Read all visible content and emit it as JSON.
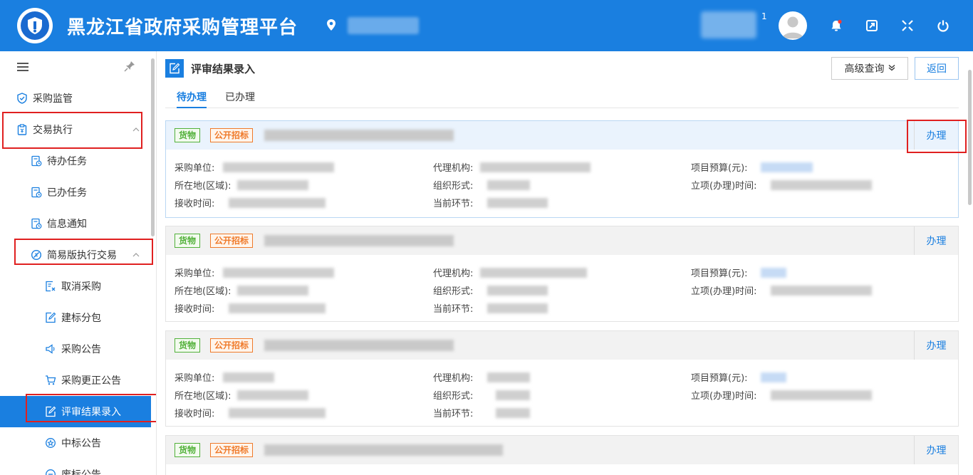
{
  "header": {
    "title": "黑龙江省政府采购管理平台",
    "user_count": "1"
  },
  "sidebar": {
    "items": [
      {
        "label": "采购监管"
      },
      {
        "label": "交易执行"
      },
      {
        "label": "待办任务"
      },
      {
        "label": "已办任务"
      },
      {
        "label": "信息通知"
      },
      {
        "label": "简易版执行交易"
      },
      {
        "label": "取消采购"
      },
      {
        "label": "建标分包"
      },
      {
        "label": "采购公告"
      },
      {
        "label": "采购更正公告"
      },
      {
        "label": "评审结果录入"
      },
      {
        "label": "中标公告"
      },
      {
        "label": "废标公告"
      }
    ]
  },
  "page": {
    "title": "评审结果录入",
    "advanced_search": "高级查询",
    "back": "返回",
    "tabs": [
      "待办理",
      "已办理"
    ]
  },
  "cards": [
    {
      "tag_goods": "货物",
      "tag_method": "公开招标",
      "action": "办理",
      "labels": {
        "unit": "采购单位:",
        "agency": "代理机构:",
        "budget": "项目预算(元):",
        "location": "所在地(区域):",
        "org_form": "组织形式:",
        "setup_time": "立项(办理)时间:",
        "receive_time": "接收时间:",
        "stage": "当前环节:"
      }
    },
    {
      "tag_goods": "货物",
      "tag_method": "公开招标",
      "action": "办理",
      "labels": {
        "unit": "采购单位:",
        "agency": "代理机构:",
        "budget": "项目预算(元):",
        "location": "所在地(区域):",
        "org_form": "组织形式:",
        "setup_time": "立项(办理)时间:",
        "receive_time": "接收时间:",
        "stage": "当前环节:"
      }
    },
    {
      "tag_goods": "货物",
      "tag_method": "公开招标",
      "action": "办理",
      "labels": {
        "unit": "采购单位:",
        "agency": "代理机构:",
        "budget": "项目预算(元):",
        "location": "所在地(区域):",
        "org_form": "组织形式:",
        "setup_time": "立项(办理)时间:",
        "receive_time": "接收时间:",
        "stage": "当前环节:"
      }
    },
    {
      "tag_goods": "货物",
      "tag_method": "公开招标",
      "action": "办理"
    }
  ]
}
